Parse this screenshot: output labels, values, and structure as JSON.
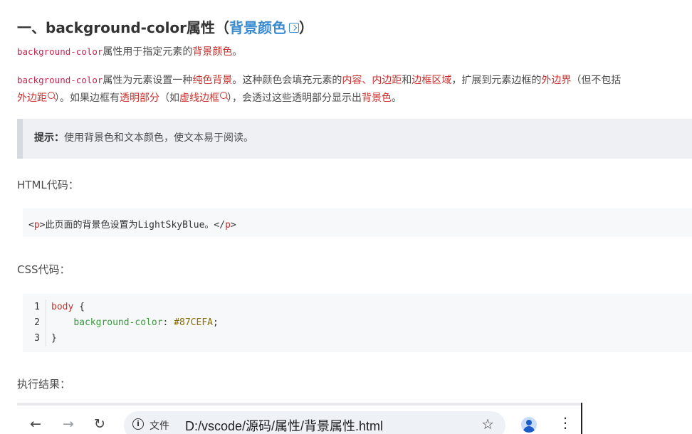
{
  "heading": {
    "prefix": "一、background-color属性（",
    "link": "背景颜色",
    "suffix": "）"
  },
  "para1": {
    "code": "background-color",
    "text1": "属性用于指定元素的",
    "link": "背景颜色",
    "text2": "。"
  },
  "para2": {
    "code": "background-color",
    "t1": "属性为元素设置一种",
    "l1": "纯色背景",
    "t2": "。这种颜色会填充元素的",
    "l2": "内容",
    "t3": "、",
    "l3": "内边距",
    "t4": "和",
    "l4": "边框区域",
    "t5": "，扩展到元素边框的",
    "l5": "外边界",
    "t6": "（但不包括",
    "l6": "外边距",
    "t7": "）。如果边框有",
    "l7": "透明部分",
    "t8": "（如",
    "l8": "虚线边框",
    "t9": "），会透过这些透明部分显示出",
    "l9": "背景色",
    "t10": "。"
  },
  "tip": {
    "bold": "提示：",
    "text": "使用背景色和文本颜色，使文本易于阅读。"
  },
  "html_label": "HTML代码：",
  "html_code": {
    "open_lt": "<",
    "open_tag": "p",
    "open_gt": ">",
    "content": "此页面的背景色设置为LightSkyBlue。",
    "close_lt": "</",
    "close_tag": "p",
    "close_gt": ">"
  },
  "css_label": "CSS代码：",
  "css_code": {
    "line_numbers": [
      "1",
      "2",
      "3"
    ],
    "selector": "body",
    "open_brace": " {",
    "indent": "    ",
    "property": "background-color",
    "colon": ": ",
    "value": "#87CEFA",
    "semicolon": ";",
    "close_brace": "}"
  },
  "result_label": "执行结果：",
  "browser": {
    "back_icon": "arrow-left-icon",
    "forward_icon": "arrow-right-icon",
    "reload_icon": "reload-icon",
    "info_icon": "info-icon",
    "file_label": "文件",
    "url": "D:/vscode/源码/属性/背景属性.html",
    "star_icon": "star-icon",
    "profile_icon": "profile-icon",
    "menu_icon": "more-vert-icon"
  }
}
